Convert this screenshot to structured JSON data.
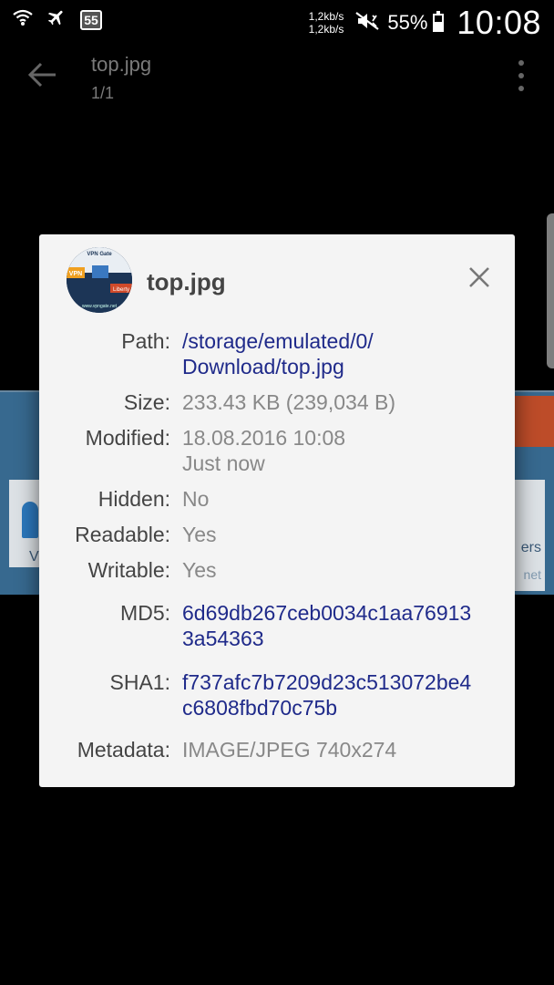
{
  "status_bar": {
    "notification_count": "55",
    "net_speed_up": "1,2kb/s",
    "net_speed_down": "1,2kb/s",
    "battery_percent": "55%",
    "battery_level": 0.55,
    "time": "10:08",
    "icons": [
      "wifi-icon",
      "airplane-mode-icon",
      "notification-badge",
      "mute-icon",
      "battery-icon"
    ]
  },
  "toolbar": {
    "title": "top.jpg",
    "subtitle": "1/1",
    "back_icon": "arrow-left-icon",
    "more_icon": "more-vert-icon"
  },
  "background": {
    "left_text": "V",
    "right_text": "ers",
    "right_text2": "net"
  },
  "dialog": {
    "title": "top.jpg",
    "close_icon": "close-icon",
    "thumbnail_texts": [
      "VPN Gate",
      "VPN",
      "Liberty",
      "www.vpngate.net"
    ],
    "rows": [
      {
        "label": "Path:",
        "lines": [
          "/storage/emulated/0/",
          "Download/top.jpg"
        ],
        "link": true
      },
      {
        "label": "Size:",
        "lines": [
          "233.43 KB (239,034 B)"
        ],
        "link": false
      },
      {
        "label": "Modified:",
        "lines": [
          "18.08.2016 10:08",
          "Just now"
        ],
        "link": false
      },
      {
        "label": "Hidden:",
        "lines": [
          "No"
        ],
        "link": false
      },
      {
        "label": "Readable:",
        "lines": [
          "Yes"
        ],
        "link": false
      },
      {
        "label": "Writable:",
        "lines": [
          "Yes"
        ],
        "link": false
      },
      {
        "label": "MD5:",
        "lines": [
          "6d69db267ceb0034c1aa76913",
          "3a54363"
        ],
        "link": true
      },
      {
        "label": "SHA1:",
        "lines": [
          "f737afc7b7209d23c513072be4",
          "c6808fbd70c75b"
        ],
        "link": true
      },
      {
        "label": "Metadata:",
        "lines": [
          "IMAGE/JPEG 740x274"
        ],
        "link": false
      }
    ]
  },
  "colors": {
    "link": "#1f2a8a",
    "value": "#888888",
    "label": "#444444",
    "dialog_bg": "#f4f4f4"
  }
}
